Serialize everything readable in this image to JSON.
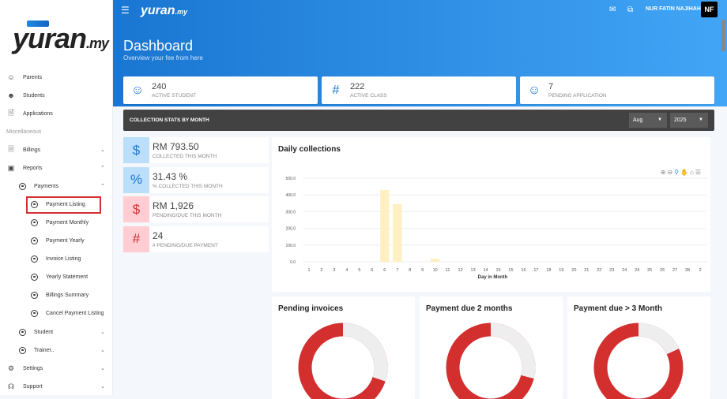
{
  "sidebar": {
    "logo": "yuran.my",
    "items": [
      {
        "label": "Parents",
        "icon": "parents-icon"
      },
      {
        "label": "Students",
        "icon": "students-icon"
      },
      {
        "label": "Applications",
        "icon": "document-icon"
      }
    ],
    "section": "Miscellaneous",
    "billings": "Billings",
    "reports": "Reports",
    "payments": "Payments",
    "payment_sub": [
      "Payment Listing",
      "Payment Monthly",
      "Payment Yearly",
      "Invoice Listing",
      "Yearly Statement",
      "Billings Summary",
      "Cancel Payment Listing"
    ],
    "student": "Student",
    "trainer": "Trainer..",
    "settings": "Settings",
    "support": "Support"
  },
  "topbar": {
    "logo": "yuran.my",
    "user": "NUR FATIN NAJIHAH",
    "initials": "NF"
  },
  "header": {
    "title": "Dashboard",
    "subtitle": "Overview your fee from here"
  },
  "stats": [
    {
      "value": "240",
      "label": "ACTIVE STUDENT"
    },
    {
      "value": "222",
      "label": "ACTIVE CLASS"
    },
    {
      "value": "7",
      "label": "PENDING APPLICATION"
    }
  ],
  "collection": {
    "title": "COLLECTION STATS BY MONTH",
    "month": "Aug",
    "year": "2025"
  },
  "mini": [
    {
      "value": "RM 793.50",
      "label": "COLLECTED THIS MONTH",
      "icon": "$"
    },
    {
      "value": "31.43 %",
      "label": "% COLLECTED THIS MONTH",
      "icon": "%"
    },
    {
      "value": "RM 1,926",
      "label": "PENDING/DUE THIS MONTH",
      "icon": "$"
    },
    {
      "value": "24",
      "label": "# PENDING/DUE PAYMENT",
      "icon": "#"
    }
  ],
  "colors": {
    "bar": "#fff0c2",
    "red": "#d32f2f",
    "gray": "#eeeeee",
    "blue": "#1976d2"
  },
  "chart_data": {
    "type": "bar",
    "title": "Daily collections",
    "xlabel": "Day in Month",
    "ylabel": "",
    "ylim": [
      0,
      500
    ],
    "yticks": [
      "0.0",
      "100.0",
      "200.0",
      "300.0",
      "400.0",
      "500.0"
    ],
    "categories": [
      "1",
      "2",
      "3",
      "4",
      "5",
      "6",
      "6",
      "7",
      "8",
      "9",
      "10",
      "11",
      "12",
      "13",
      "14",
      "15",
      "15",
      "16",
      "17",
      "18",
      "19",
      "20",
      "21",
      "22",
      "23",
      "24",
      "24",
      "25",
      "26",
      "27",
      "28",
      "2"
    ],
    "values": [
      0,
      0,
      0,
      0,
      0,
      0,
      430,
      345,
      0,
      0,
      18.5,
      0,
      0,
      0,
      0,
      0,
      0,
      0,
      0,
      0,
      0,
      0,
      0,
      0,
      0,
      0,
      0,
      0,
      0,
      0,
      0,
      0
    ]
  },
  "donuts": [
    {
      "title": "Pending invoices",
      "paid_fraction": 0.3
    },
    {
      "title": "Payment due 2 months",
      "paid_fraction": 0.29
    },
    {
      "title": "Payment due > 3 Month",
      "paid_fraction": 0.18
    }
  ]
}
